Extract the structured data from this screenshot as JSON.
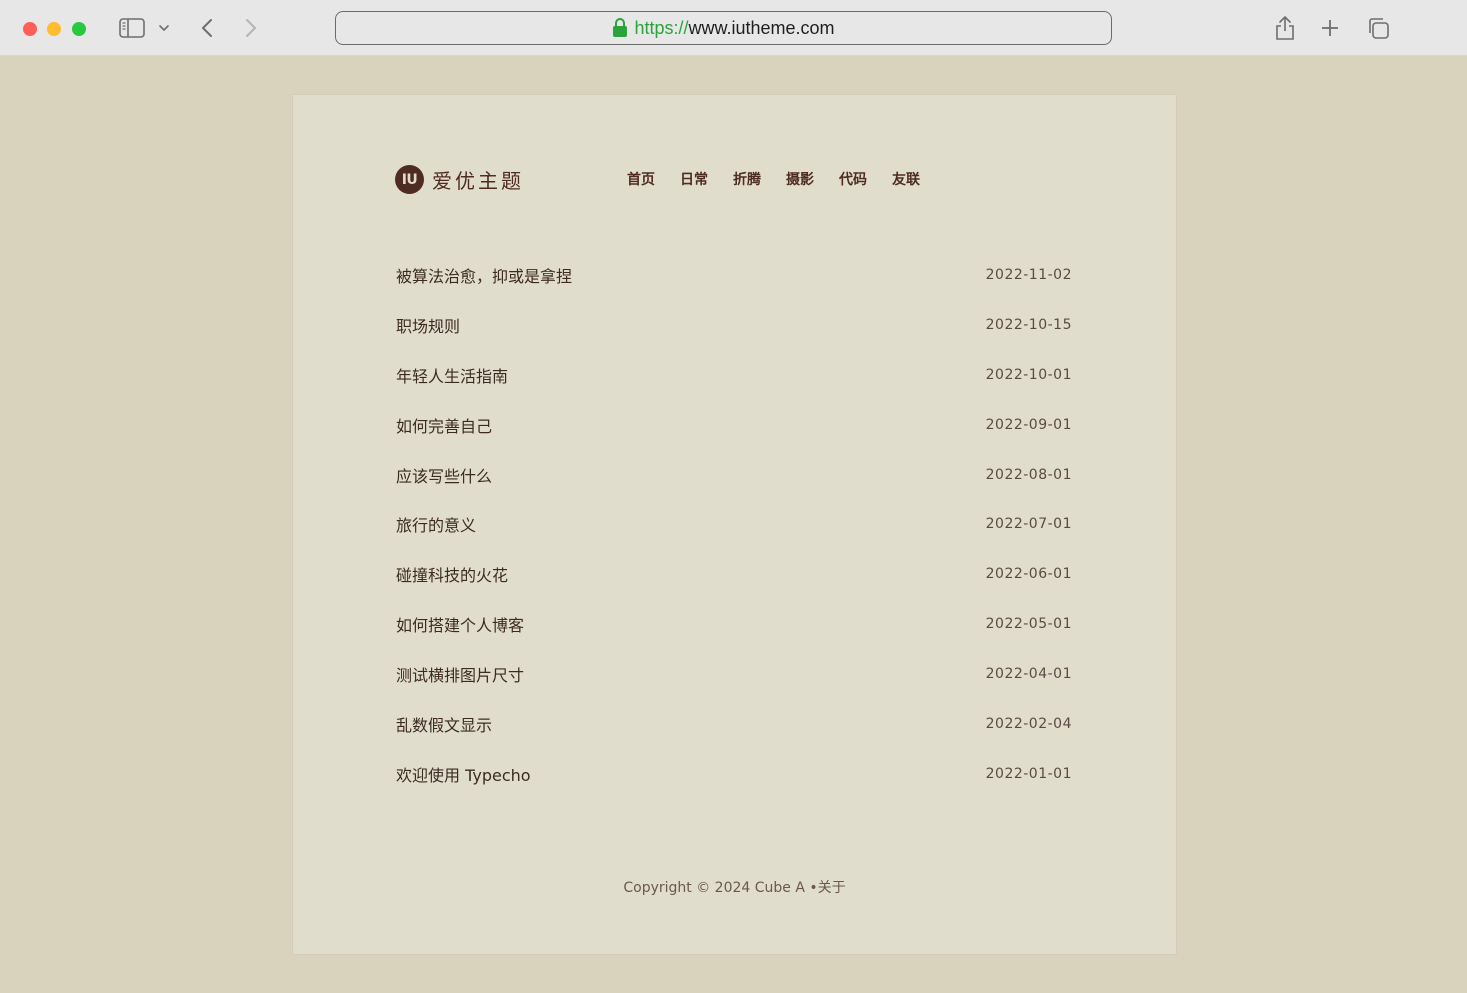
{
  "browser": {
    "url_scheme": "https://",
    "url_host": "www.iutheme.com",
    "icons": {
      "sidebar": "sidebar-icon",
      "chevron": "chevron-down-icon",
      "back": "chevron-left-icon",
      "forward": "chevron-right-icon",
      "lock": "lock-icon",
      "share": "share-icon",
      "new_tab": "plus-icon",
      "tabs": "tabs-overview-icon"
    },
    "colors": {
      "close": "#fe5f57",
      "minimize": "#febc2e",
      "maximize": "#28c840",
      "secure": "#2aa33a"
    }
  },
  "site": {
    "logo_badge": "IU",
    "logo_text": "爱优主题",
    "nav": [
      {
        "label": "首页"
      },
      {
        "label": "日常"
      },
      {
        "label": "折腾"
      },
      {
        "label": "摄影"
      },
      {
        "label": "代码"
      },
      {
        "label": "友联"
      }
    ],
    "posts": [
      {
        "title": "被算法治愈，抑或是拿捏",
        "date": "2022-11-02"
      },
      {
        "title": "职场规则",
        "date": "2022-10-15"
      },
      {
        "title": "年轻人生活指南",
        "date": "2022-10-01"
      },
      {
        "title": "如何完善自己",
        "date": "2022-09-01"
      },
      {
        "title": "应该写些什么",
        "date": "2022-08-01"
      },
      {
        "title": "旅行的意义",
        "date": "2022-07-01"
      },
      {
        "title": "碰撞科技的火花",
        "date": "2022-06-01"
      },
      {
        "title": "如何搭建个人博客",
        "date": "2022-05-01"
      },
      {
        "title": "测试横排图片尺寸",
        "date": "2022-04-01"
      },
      {
        "title": "乱数假文显示",
        "date": "2022-02-04"
      },
      {
        "title": "欢迎使用 Typecho",
        "date": "2022-01-01"
      }
    ],
    "footer": {
      "copyright": "Copyright © 2024 Cube A •",
      "about_link": "关于"
    },
    "colors": {
      "brand": "#4e2c22",
      "page_bg": "#d9d2bd",
      "card_bg": "#e1ddcd"
    }
  }
}
